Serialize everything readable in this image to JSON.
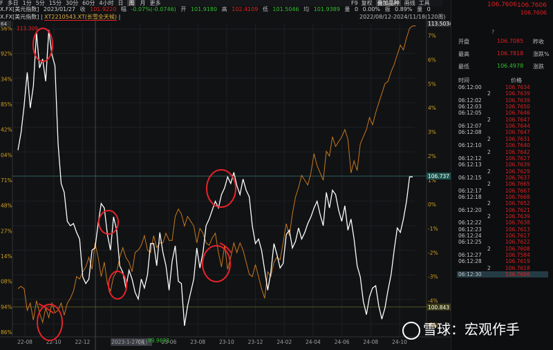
{
  "toolbar": [
    "F",
    "多日",
    "1分",
    "5分",
    "15分",
    "30分",
    "60分",
    "4小时",
    "日",
    "周",
    "月",
    "更多"
  ],
  "toolbar_selected": "周",
  "toolbar_right": [
    "F9",
    "复权",
    "叠加品种",
    "画线",
    "工具"
  ],
  "quote": {
    "symbol": "X.FX[美元指数]",
    "date": "2023/01/27",
    "close_label": "收",
    "close": "101.9220",
    "change_label": "幅",
    "change": "-0.07%(-0.0746)",
    "open_label": "开",
    "open": "101.9180",
    "high_label": "高",
    "high": "102.4109",
    "low_label": "低",
    "low": "101.5046",
    "avg_label": "均",
    "avg": "101.9389",
    "vol_label": "量",
    "vol": "0",
    "pct_label": "",
    "pct": "0.00%",
    "amp_label": "振",
    "amp": "0.89%",
    "qty_label": "量",
    "qty": "0"
  },
  "symbar": {
    "left": "X.FX[美元指数] |",
    "overlay": "XT2210543.XT(长雪全天候)",
    "tail": "|",
    "range": "2022/08/12-2024/11/18(120周)"
  },
  "right_panel": {
    "top_price": "106.7606",
    "second_price": "106.7606",
    "third_price": "106.7606",
    "q": "?",
    "stats": [
      {
        "label": "开盘",
        "value": "106.7085",
        "label2": "昨收"
      },
      {
        "label": "最高",
        "value": "106.7818",
        "label2": "涨跌%"
      },
      {
        "label": "最低",
        "value": "106.4978",
        "label2": "涨跌"
      }
    ],
    "tick_header": {
      "time": "时间",
      "price": "价格"
    },
    "ticks": [
      {
        "t": "06:12:00",
        "p": "106.7634"
      },
      {
        "t": "2",
        "p": "106.7639"
      },
      {
        "t": "06:12:02",
        "p": "106.7639"
      },
      {
        "t": "06:12:03",
        "p": "106.7650"
      },
      {
        "t": "06:12:05",
        "p": "106.7646"
      },
      {
        "t": "2",
        "p": "106.7647"
      },
      {
        "t": "06:12:07",
        "p": "106.7644"
      },
      {
        "t": "06:12:08",
        "p": "106.7647"
      },
      {
        "t": "2",
        "p": "106.7631"
      },
      {
        "t": "06:12:10",
        "p": "106.7640"
      },
      {
        "t": "2",
        "p": "106.7642"
      },
      {
        "t": "06:12:12",
        "p": "106.7627"
      },
      {
        "t": "06:12:13",
        "p": "106.7639"
      },
      {
        "t": "2",
        "p": "106.7629"
      },
      {
        "t": "06:12:15",
        "p": "106.7637"
      },
      {
        "t": "2",
        "p": "106.7665"
      },
      {
        "t": "06:12:17",
        "p": "106.7667"
      },
      {
        "t": "06:12:18",
        "p": "106.7668"
      },
      {
        "t": "2",
        "p": "106.7652"
      },
      {
        "t": "06:12:20",
        "p": "106.7621"
      },
      {
        "t": "2",
        "p": "106.7639"
      },
      {
        "t": "06:12:22",
        "p": "106.7638"
      },
      {
        "t": "06:12:23",
        "p": "106.7613"
      },
      {
        "t": "06:12:24",
        "p": "106.7617"
      },
      {
        "t": "06:12:25",
        "p": "106.7622"
      },
      {
        "t": "2",
        "p": "106.7608"
      },
      {
        "t": "06:12:27",
        "p": "106.7584"
      },
      {
        "t": "06:12:28",
        "p": "106.7619"
      },
      {
        "t": "2",
        "p": "106.7618"
      },
      {
        "t": "06:12:30",
        "p": "106.7606"
      }
    ]
  },
  "watermark": "雪球：宏观作手",
  "colors": {
    "white_series": "#ffffff",
    "orange_series": "#c8791e",
    "annotation": "#e8232a",
    "up": "#e02020",
    "down": "#30c030"
  },
  "chart_data": {
    "type": "line",
    "x_ticks": [
      "22-08",
      "22-10",
      "22-12",
      "2023-1-27(五)",
      "-04",
      "23-06",
      "23-08",
      "23-10",
      "23-12",
      "24-02",
      "24-04",
      "24-06",
      "24-08",
      "24-10"
    ],
    "left_axis_ticks": [
      "56%",
      "92%",
      "34%",
      "85%",
      "42%",
      "04%",
      "71%",
      "48%",
      "27%",
      "14%",
      "08%",
      "94%",
      "86%"
    ],
    "right_axis_ticks": [
      "7%",
      "6%",
      "5%",
      "4%",
      "3%",
      "2%",
      "1%",
      "0%",
      "-1%",
      "-2%",
      "-3%",
      "-4%",
      "-5%"
    ],
    "price_box_top": "113.5034",
    "price_box_mid": "106.737",
    "price_box_bottom": "100.843",
    "left_top_label": "64",
    "high_label": "113.309",
    "low_label": "99.9633",
    "series": [
      {
        "name": "X.FX[美元指数]",
        "values": [
          107.9,
          108.7,
          109.9,
          111.4,
          109.8,
          110.8,
          113.2,
          111.6,
          112.0,
          111.0,
          113.3,
          112.2,
          111.7,
          108.2,
          106.4,
          106.0,
          104.7,
          104.5,
          104.6,
          104.2,
          103.9,
          102.2,
          101.9,
          102.1,
          103.4,
          103.5,
          104.6,
          105.5,
          105.3,
          104.1,
          103.4,
          104.9,
          104.3,
          102.7,
          102.4,
          101.7,
          102.5,
          102.1,
          101.5,
          101.2,
          102.1,
          101.7,
          102.3,
          103.7,
          103.7,
          102.7,
          104.2,
          103.3,
          102.7,
          101.6,
          102.9,
          103.6,
          102.0,
          101.9,
          100.0,
          100.9,
          101.5,
          102.1,
          103.5,
          102.6,
          103.3,
          104.5,
          104.8,
          105.2,
          105.6,
          105.3,
          105.9,
          106.2,
          106.7,
          106.4,
          106.9,
          106.3,
          105.9,
          106.6,
          106.1,
          105.8,
          104.5,
          103.7,
          103.9,
          103.4,
          102.5,
          101.6,
          102.4,
          103.7,
          103.2,
          102.6,
          102.8,
          104.1,
          104.3,
          103.5,
          103.8,
          104.4,
          103.9,
          104.2,
          104.6,
          104.9,
          105.3,
          105.6,
          105.0,
          104.5,
          106.0,
          105.3,
          106.1,
          105.9,
          105.2,
          104.7,
          105.4,
          104.3,
          104.8,
          103.9,
          102.7,
          102.2,
          101.1,
          100.5,
          101.3,
          101.7,
          101.8,
          100.9,
          100.3,
          100.8,
          101.6,
          102.3,
          103.4,
          104.4,
          104.2,
          104.8,
          105.6,
          106.7,
          106.7
        ],
        "scale": "left"
      },
      {
        "name": "XT2210543.XT(长雪全天候)",
        "values": [
          -3.5,
          -3.4,
          -3.5,
          -4.4,
          -4.1,
          -4.8,
          -4.0,
          -4.5,
          -4.9,
          -4.3,
          -4.7,
          -4.1,
          -4.5,
          -4.4,
          -4.1,
          -4.6,
          -4.1,
          -3.9,
          -3.6,
          -3.0,
          -3.1,
          -2.8,
          -2.6,
          -2.2,
          -2.7,
          -1.6,
          -2.2,
          -3.0,
          -2.4,
          -3.3,
          -3.6,
          -3.0,
          -2.8,
          -2.2,
          -1.8,
          -2.2,
          -2.4,
          -2.8,
          -2.0,
          -1.9,
          -1.7,
          -1.3,
          -1.9,
          -2.0,
          -1.3,
          -1.8,
          -1.6,
          -1.6,
          -1.2,
          -1.5,
          -1.5,
          -0.5,
          -0.2,
          -0.4,
          -0.9,
          -0.5,
          -0.7,
          -0.9,
          -1.6,
          -1.0,
          -1.2,
          -1.6,
          -1.7,
          -1.4,
          -1.2,
          -2.0,
          -2.6,
          -1.7,
          -2.7,
          -2.2,
          -1.6,
          -2.0,
          -1.6,
          -1.9,
          -2.4,
          -2.9,
          -3.0,
          -2.5,
          -3.0,
          -3.5,
          -3.9,
          -2.8,
          -3.0,
          -2.4,
          -2.2,
          -2.3,
          -1.6,
          -0.8,
          -1.3,
          -0.4,
          0.3,
          0.7,
          1.2,
          1.0,
          0.8,
          1.3,
          2.1,
          1.6,
          1.3,
          1.0,
          2.2,
          2.0,
          2.8,
          2.4,
          2.6,
          2.8,
          3.1,
          2.7,
          1.3,
          1.8,
          1.4,
          2.5,
          2.8,
          3.1,
          3.6,
          3.3,
          3.8,
          4.2,
          4.6,
          5.0,
          5.1,
          5.5,
          5.8,
          6.2,
          6.6,
          6.4,
          6.9,
          7.3,
          7.4,
          7.4
        ],
        "scale": "right"
      }
    ],
    "left_range": [
      99.5,
      113.6
    ],
    "right_range": [
      -5.5,
      7.5
    ]
  }
}
